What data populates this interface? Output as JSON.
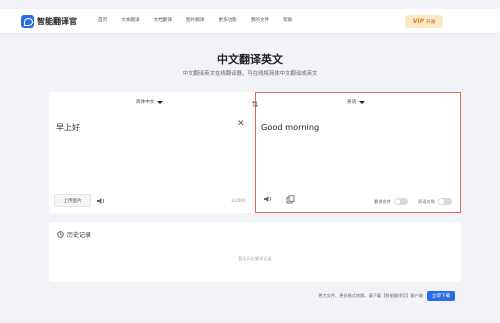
{
  "header": {
    "logo_text": "智能翻译官",
    "nav": [
      "首页",
      "文本翻译",
      "文档翻译",
      "图片翻译",
      "更多功能",
      "我的文件",
      "帮助"
    ],
    "vip": {
      "badge": "VIP",
      "label": "开通"
    }
  },
  "hero": {
    "title": "中文翻译英文",
    "subtitle": "中文翻译英文在线翻译器，可在线将简体中文翻译成英文"
  },
  "source": {
    "language": "简体中文",
    "text": "早上好",
    "upload_label": "上传图片",
    "counter": "3/2000"
  },
  "target": {
    "language": "英语",
    "text": "Good morning",
    "toggle1_label": "翻译合并",
    "toggle2_label": "双语对照"
  },
  "history": {
    "title": "历史记录",
    "empty_text": "暂无历史翻译记录"
  },
  "footer": {
    "promo_text": "更大文件、更多格式转换，请下载【智能翻译官】客户端",
    "download_label": "立即下载"
  },
  "colors": {
    "accent": "#2f6ae6",
    "highlight_border": "#e06a4e",
    "vip_bg": "#fde8c6"
  }
}
